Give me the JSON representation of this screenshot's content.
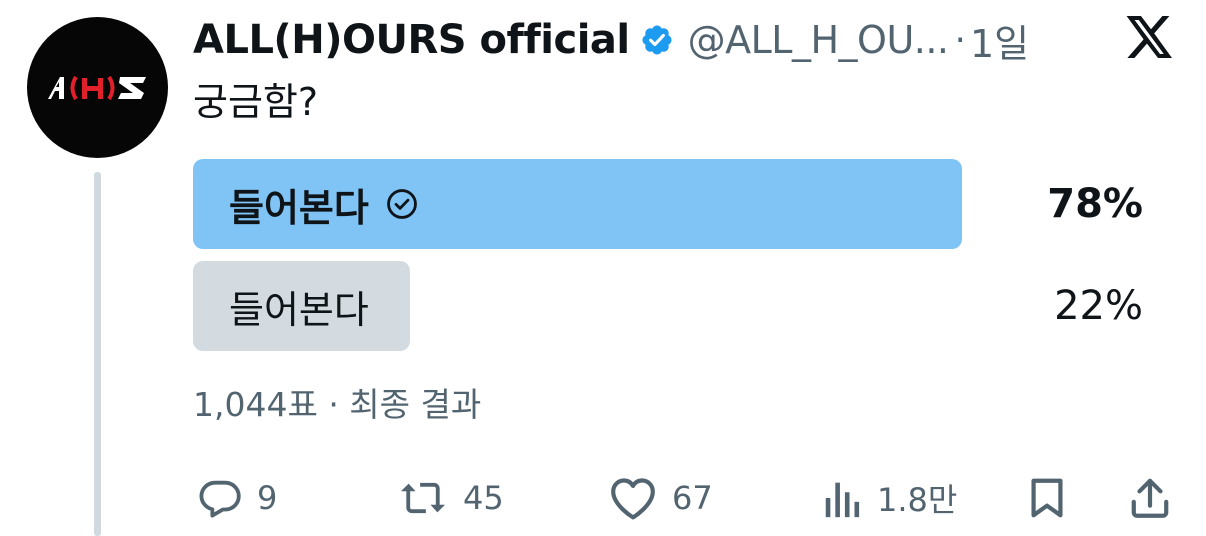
{
  "author": {
    "display_name": "ALL(H)OURS official",
    "handle": "@ALL_H_OU...",
    "separator": "·",
    "time": "1일",
    "verified": true,
    "avatar_logo_text": "A(H)S"
  },
  "tweet": {
    "text": "궁금함?"
  },
  "poll": {
    "options": [
      {
        "label": "들어본다",
        "percent_label": "78%",
        "percent": 78,
        "winner": true
      },
      {
        "label": "들어본다",
        "percent_label": "22%",
        "percent": 22,
        "winner": false
      }
    ],
    "meta": "1,044표 · 최종 결과"
  },
  "actions": {
    "replies": "9",
    "reposts": "45",
    "likes": "67",
    "views": "1.8만"
  },
  "colors": {
    "winner_fill": "#7fc4f5",
    "loser_fill": "#d3dbe0",
    "verified_badge": "#1d9bf0",
    "muted_text": "#536471",
    "primary_text": "#0f1419",
    "avatar_bg": "#060606",
    "logo_red": "#e0202a"
  },
  "icons": {
    "reply": "reply-icon",
    "repost": "repost-icon",
    "like": "heart-icon",
    "views": "views-icon",
    "bookmark": "bookmark-icon",
    "share": "share-icon",
    "platform": "x-logo-icon",
    "verified": "verified-badge-icon",
    "voted": "check-circle-icon"
  }
}
